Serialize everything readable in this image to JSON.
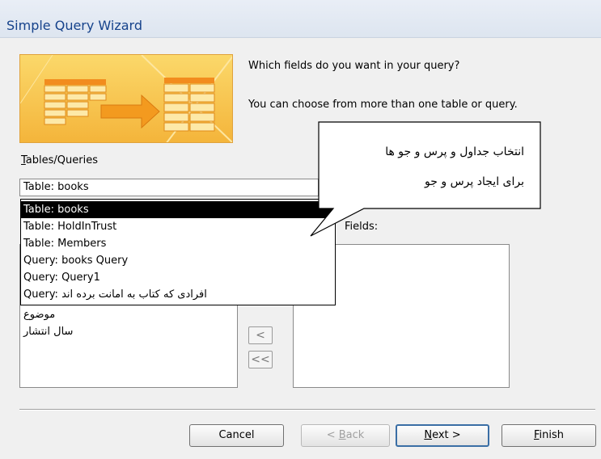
{
  "window": {
    "title": "Simple Query Wizard"
  },
  "prompt": {
    "line1": "Which fields do you want in your query?",
    "line2": "You can choose from more than one table or query."
  },
  "tables_queries": {
    "label_accesskey": "T",
    "label_rest": "ables/Queries",
    "selected": "Table: books",
    "options": [
      "Table: books",
      "Table: HoldInTrust",
      "Table: Members",
      "Query: books Query",
      "Query: Query1",
      "Query: افرادی که کتاب به امانت برده اند"
    ]
  },
  "available_fields": {
    "visible_items": [
      "موضوع",
      "سال انتشار"
    ]
  },
  "selected_fields": {
    "label": "Fields:"
  },
  "buttons": {
    "remove_one": "<",
    "remove_all": "<<",
    "cancel": "Cancel",
    "back_prefix": "< ",
    "back_accesskey": "B",
    "back_rest": "ack",
    "next_accesskey": "N",
    "next_rest": "ext >",
    "finish_accesskey": "F",
    "finish_rest": "inish"
  },
  "callout": {
    "line1": "انتخاب جداول و پرس و جو ها",
    "line2": "برای ایجاد پرس و جو"
  },
  "colors": {
    "title": "#15428b",
    "art_orange": "#f5a623",
    "art_bg": "#f7c84a"
  }
}
